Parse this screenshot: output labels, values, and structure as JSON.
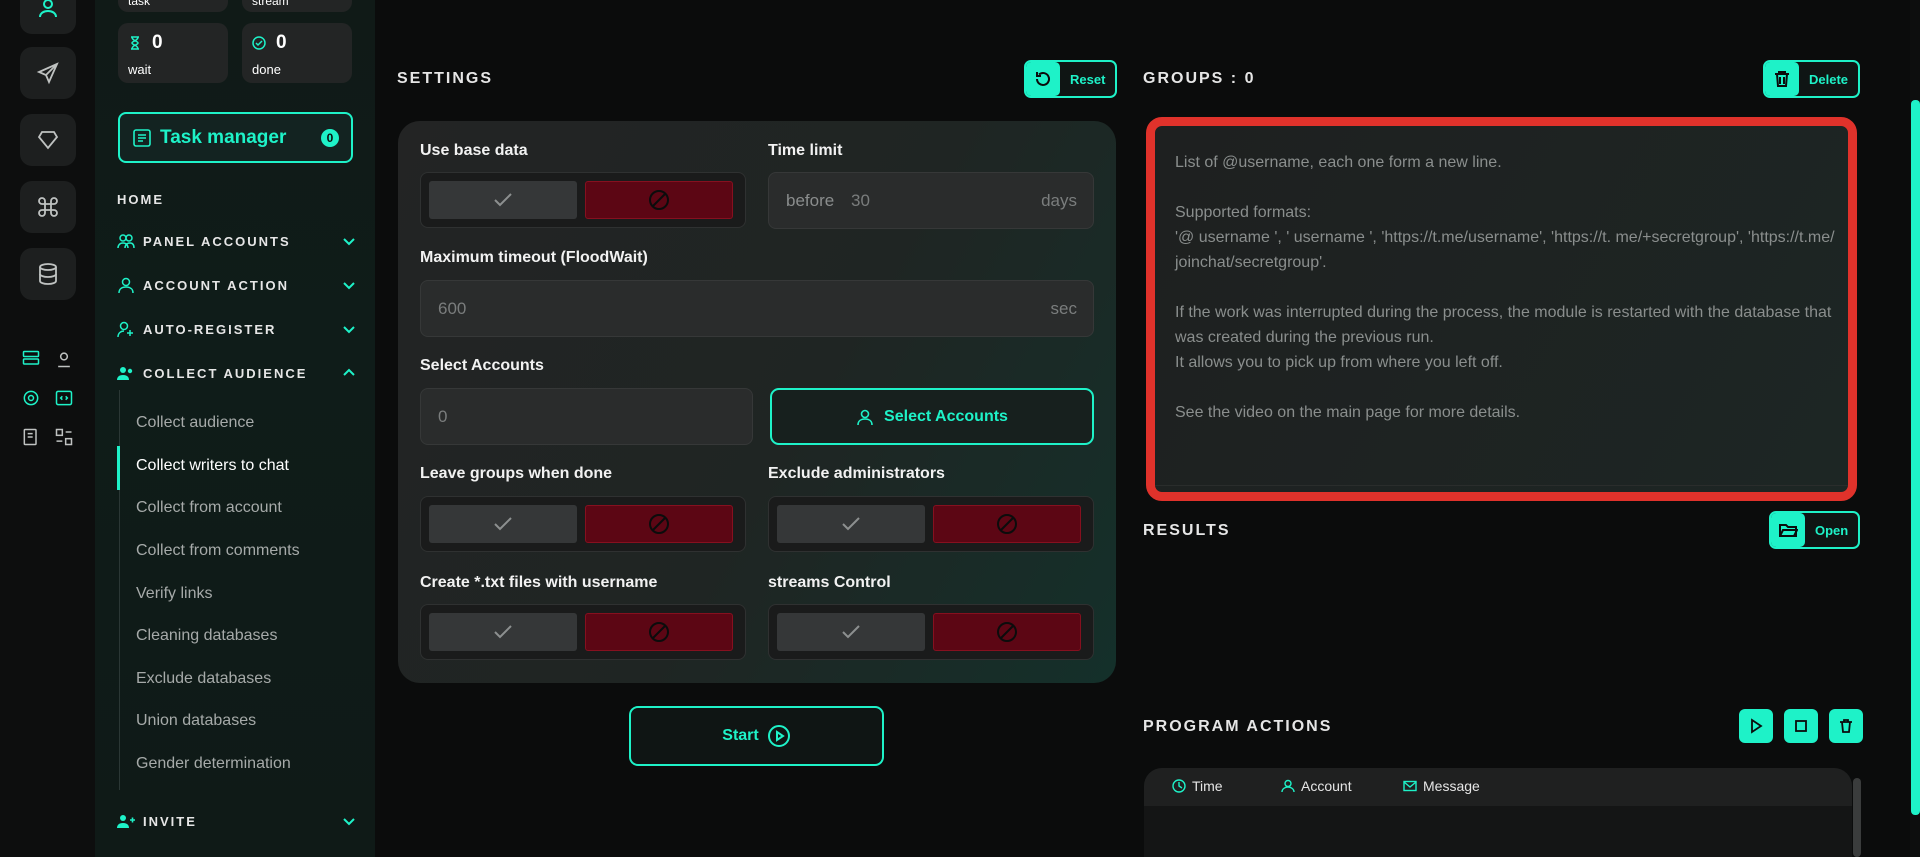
{
  "colors": {
    "accent": "#1ef2c8",
    "danger": "#5c0614",
    "highlight": "#e0322b"
  },
  "stats": {
    "top_left_label": "task",
    "top_right_label": "stream",
    "wait": {
      "value": "0",
      "label": "wait"
    },
    "done": {
      "value": "0",
      "label": "done"
    }
  },
  "task_manager": {
    "label": "Task manager",
    "count": "0"
  },
  "nav": {
    "home": "HOME",
    "sections": [
      {
        "label": "PANEL ACCOUNTS"
      },
      {
        "label": "ACCOUNT ACTION"
      },
      {
        "label": "AUTO-REGISTER"
      },
      {
        "label": "COLLECT AUDIENCE"
      },
      {
        "label": "INVITE"
      }
    ],
    "collect_items": [
      "Collect audience",
      "Collect writers to chat",
      "Collect from account",
      "Collect from comments",
      "Verify links",
      "Cleaning databases",
      "Exclude databases",
      "Union databases",
      "Gender determination"
    ]
  },
  "settings": {
    "title": "SETTINGS",
    "reset_label": "Reset",
    "use_base_data": "Use base data",
    "time_limit": {
      "label": "Time limit",
      "prefix": "before",
      "value": "30",
      "unit": "days"
    },
    "max_timeout": {
      "label": "Maximum timeout (FloodWait)",
      "value": "600",
      "unit": "sec"
    },
    "select_accounts": {
      "label": "Select Accounts",
      "value": "0",
      "button": "Select Accounts"
    },
    "leave_groups": "Leave groups when done",
    "exclude_admins": "Exclude administrators",
    "create_txt": "Create *.txt files with username",
    "streams_control": "streams Control",
    "start_label": "Start"
  },
  "groups": {
    "title": "GROUPS : 0",
    "delete_label": "Delete",
    "placeholder": "List of @username, each one form a new line.\n\nSupported formats:\n'@ username ', ' username ', 'https://t.me/username', 'https://t. me/+secretgroup', 'https://t.me/joinchat/secretgroup'.\n\nIf the work was interrupted during the process, the module is restarted with the database that was created during the previous run.\nIt allows you to pick up from where you left off.\n\nSee the video on the main page for more details."
  },
  "results": {
    "title": "RESULTS",
    "open_label": "Open"
  },
  "program_actions": {
    "title": "PROGRAM ACTIONS",
    "columns": [
      "Time",
      "Account",
      "Message"
    ]
  }
}
